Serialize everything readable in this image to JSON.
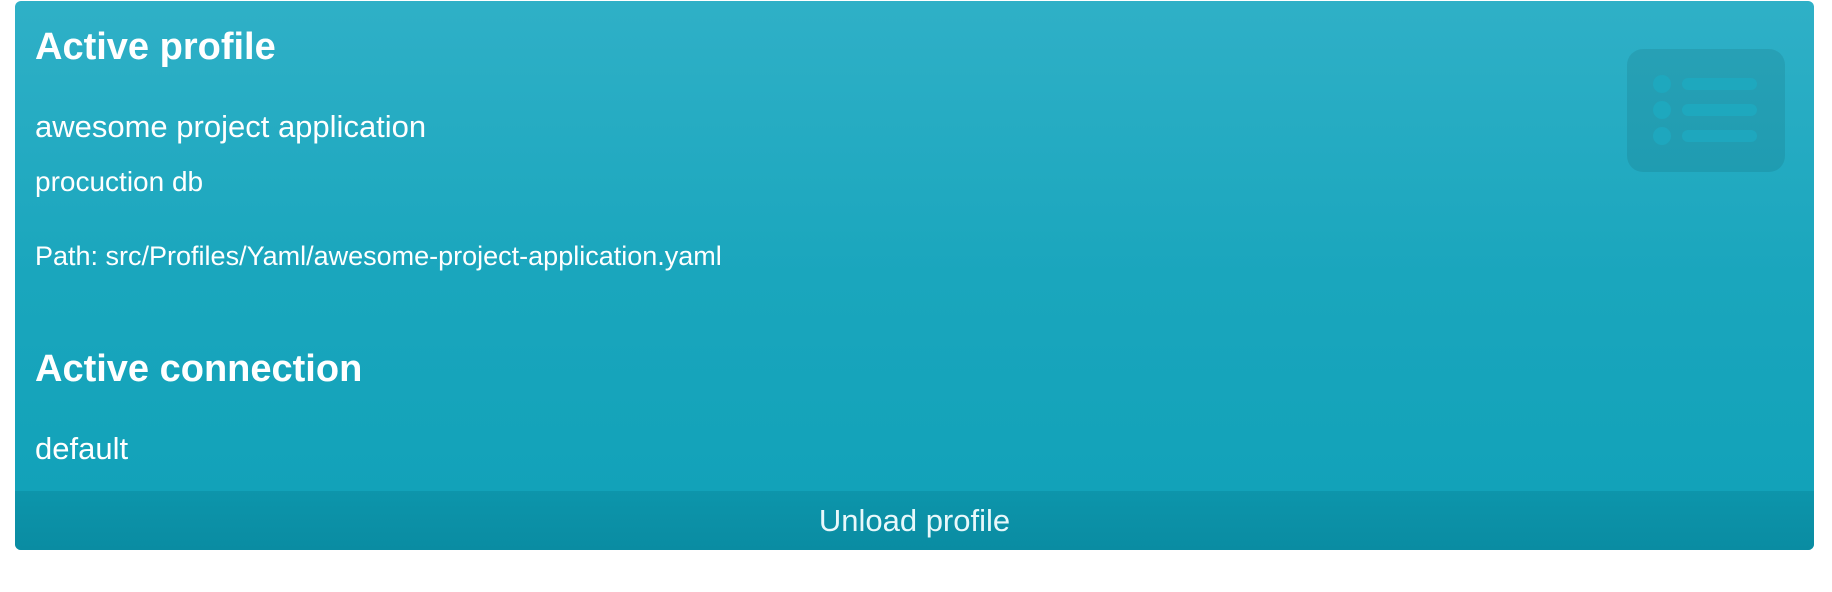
{
  "active_profile": {
    "heading": "Active profile",
    "name": "awesome project application",
    "description": "procuction db",
    "path": "Path: src/Profiles/Yaml/awesome-project-application.yaml",
    "icon": "list-icon"
  },
  "active_connection": {
    "heading": "Active connection",
    "name": "default"
  },
  "footer": {
    "unload_label": "Unload profile"
  },
  "colors": {
    "card_top": "#2fb0c7",
    "card_bottom": "#10a1b8",
    "footer": "#0a8ca2",
    "text": "#ffffff"
  }
}
